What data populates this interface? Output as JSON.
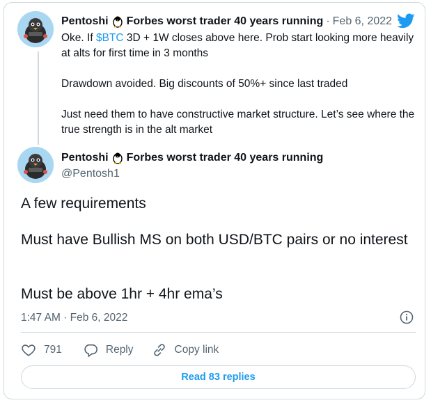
{
  "tweet1": {
    "author_name": "Pentoshi",
    "author_suffix": "Forbes worst trader 40 years running",
    "separator": "·",
    "date": "Feb 6, 2022",
    "line1_prefix": "Oke. If ",
    "cashtag": "$BTC",
    "line1_suffix": " 3D + 1W closes above here. Prob start looking more heavily at alts for first time in 3 months",
    "para2": "Drawdown avoided. Big discounts of 50%+ since last traded",
    "para3": "Just need them to have constructive market structure. Let’s see where the true strength is in the alt market"
  },
  "tweet2": {
    "author_name": "Pentoshi",
    "author_suffix": "Forbes worst trader 40 years running",
    "handle": "@Pentosh1",
    "para1": "A few requirements",
    "para2": "Must have Bullish MS on both USD/BTC pairs or no interest",
    "para3": "Must be above 1hr + 4hr ema’s",
    "timestamp": "1:47 AM · Feb 6, 2022"
  },
  "actions": {
    "likes": "791",
    "reply_label": "Reply",
    "copy_link_label": "Copy link"
  },
  "read_replies_label": "Read 83 replies",
  "colors": {
    "accent": "#1d9bf0",
    "muted": "#536471",
    "border": "#cfd9de"
  }
}
